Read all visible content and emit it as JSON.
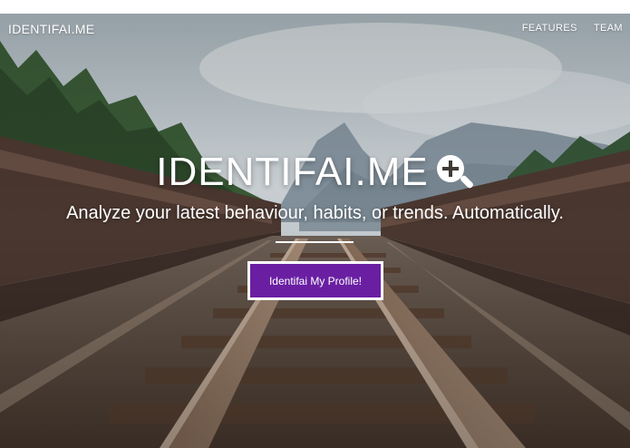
{
  "navbar": {
    "brand": "IDENTIFAI.ME",
    "links": [
      {
        "label": "FEATURES"
      },
      {
        "label": "TEAM"
      }
    ]
  },
  "hero": {
    "title": "IDENTIFAI.ME",
    "subtitle": "Analyze your latest behaviour, habits, or trends. Automatically.",
    "cta_label": "Identifai My Profile!"
  },
  "colors": {
    "cta_background": "#6a1fa2",
    "text": "#ffffff"
  },
  "icons": {
    "title_icon": "magnifier-plus-icon"
  }
}
